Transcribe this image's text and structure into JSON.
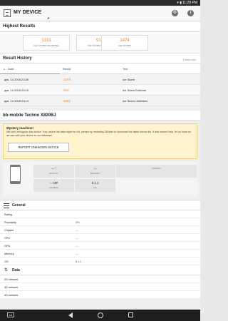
{
  "status_bar": {
    "time": "11:28 PM",
    "signal": "▾ ▮"
  },
  "app_bar": {
    "title": "MY DEVICE",
    "settings_icon": "gear-icon",
    "info_icon": "info-icon",
    "info_glyph": "i",
    "gear_glyph": "⚙",
    "dropdown_glyph": "◢"
  },
  "highest_results": {
    "title": "Highest Results",
    "scores": [
      {
        "value": "1331",
        "label": "ICE STORM UNLIMITED"
      },
      {
        "value": "919",
        "label": "ICE STORM EXTREME"
      },
      {
        "value": "1474",
        "label": "ICE STORM"
      }
    ]
  },
  "result_history": {
    "title": "Result History",
    "count": "3 test runs",
    "columns": [
      "Date",
      "Result",
      "Test"
    ],
    "rows": [
      {
        "date": "дек. 14 2015 23:26",
        "result": "1474",
        "test": "Ice Storm"
      },
      {
        "date": "дек. 14 2015 23:19",
        "result": "919",
        "test": "Ice Storm Extreme"
      },
      {
        "date": "дек. 14 2015 23:13",
        "result": "1331",
        "test": "Ice Storm Unlimited"
      }
    ]
  },
  "device": {
    "name": "bb-mobile Techno X800BJ",
    "notice_title": "Mystery machine!",
    "notice_body": "We don't recognize this device. Your device list data might be old, please try restarting 3DMark to download the latest device list. If that doesn't help, let us know so we can add your device to our database.",
    "report_button": "REPORT UNKNOWN DEVICE",
    "phone_label": "",
    "specs": [
      {
        "value": "--- \"",
        "key": "DISPLAY"
      },
      {
        "value": "---",
        "key": "MEMORY"
      },
      {
        "value": "",
        "key": "CHIPSET"
      },
      {
        "value": "--- MP",
        "key": "CAMERA"
      },
      {
        "value": "5.1.1",
        "key": "OS"
      }
    ]
  },
  "general": {
    "title": "General",
    "rows": [
      {
        "key": "Rating",
        "value": ""
      },
      {
        "key": "Popularity",
        "value": "0%"
      },
      {
        "key": "Chipset",
        "value": "---"
      },
      {
        "key": "CPU",
        "value": "---"
      },
      {
        "key": "GPU",
        "value": "---"
      },
      {
        "key": "Memory",
        "value": "---"
      },
      {
        "key": "OS",
        "value": "5.1.1"
      }
    ]
  },
  "data": {
    "title": "Data",
    "rows": [
      {
        "key": "2G network",
        "value": ""
      },
      {
        "key": "3G network",
        "value": ""
      },
      {
        "key": "4G network",
        "value": ""
      }
    ]
  },
  "nav": {
    "keyboard_glyph": "⌨"
  },
  "colors": {
    "accent": "#f08020",
    "notice_bg": "#fff4cd"
  }
}
